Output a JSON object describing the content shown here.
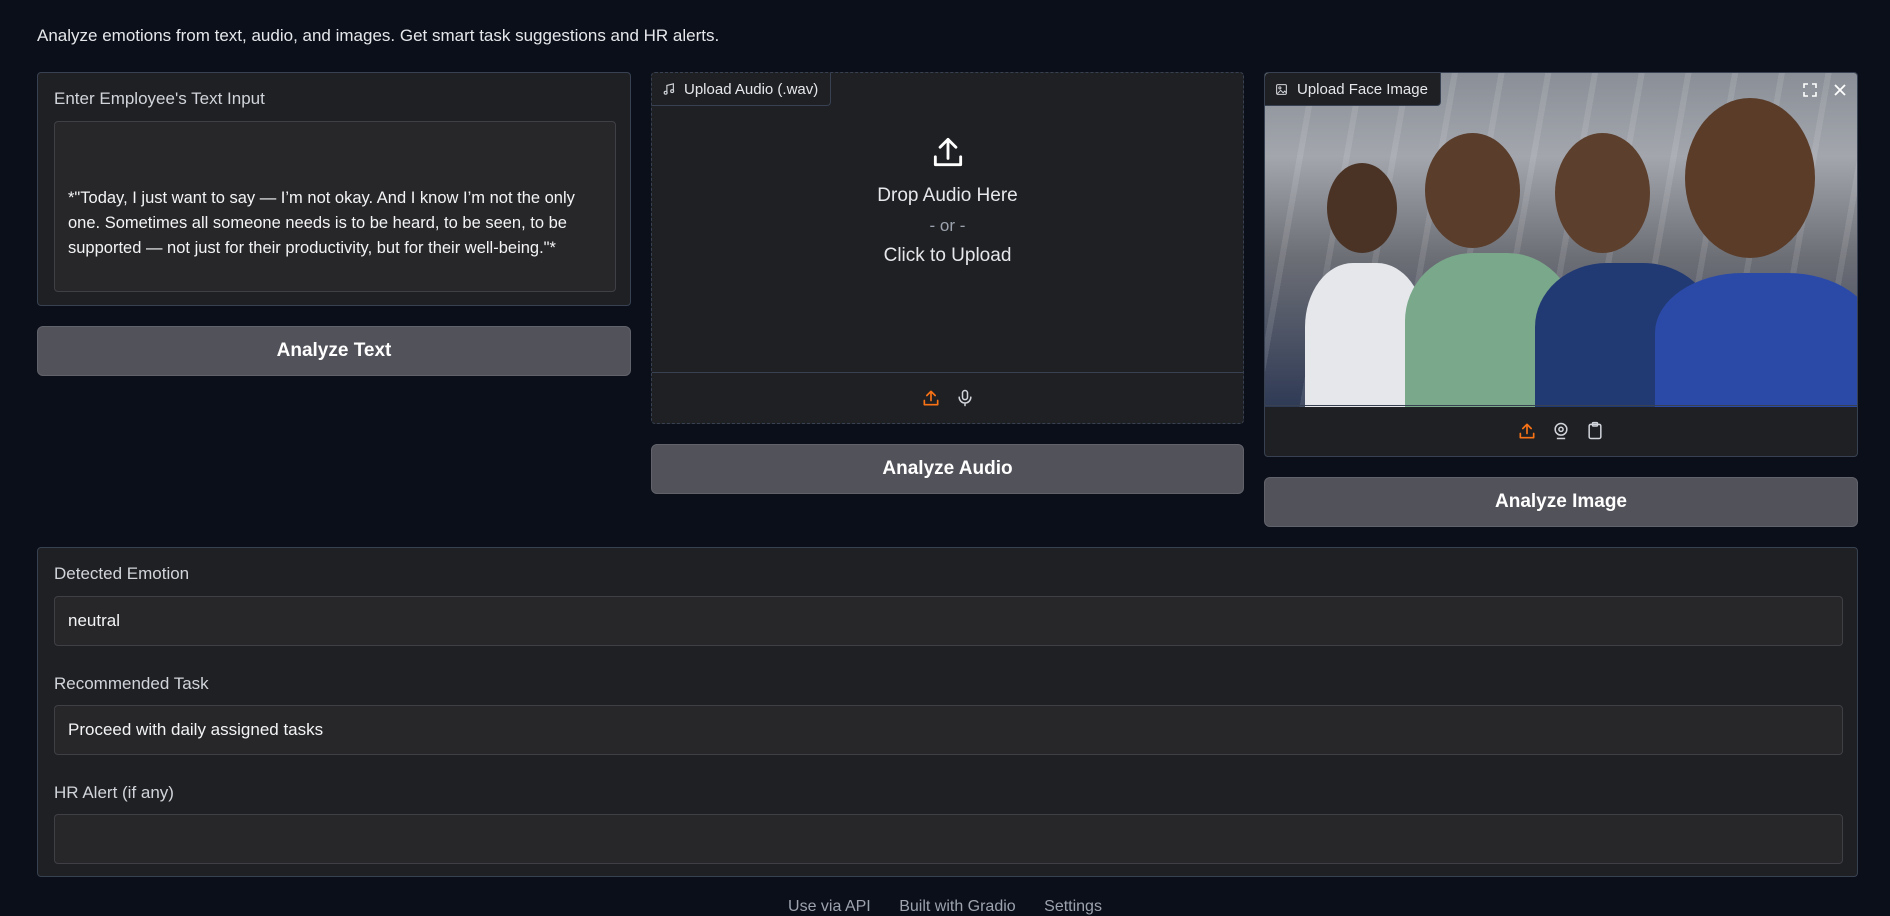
{
  "description": "Analyze emotions from text, audio, and images. Get smart task suggestions and HR alerts.",
  "text_input": {
    "label": "Enter Employee's Text Input",
    "value": "*\"Today, I just want to say — I’m not okay. And I know I’m not the only one. Sometimes all someone needs is to be heard, to be seen, to be supported — not just for their productivity, but for their well-being.\"*"
  },
  "buttons": {
    "analyze_text": "Analyze Text",
    "analyze_audio": "Analyze Audio",
    "analyze_image": "Analyze Image"
  },
  "audio_upload": {
    "label": "Upload Audio (.wav)",
    "drop_text": "Drop Audio Here",
    "or_text": "- or -",
    "click_text": "Click to Upload",
    "icons": [
      "music-note-icon",
      "upload-icon",
      "microphone-icon"
    ]
  },
  "image_upload": {
    "label": "Upload Face Image",
    "icons": [
      "image-icon",
      "fullscreen-icon",
      "close-icon",
      "upload-icon",
      "webcam-icon",
      "clipboard-icon"
    ]
  },
  "results": {
    "emotion_label": "Detected Emotion",
    "emotion_value": "neutral",
    "task_label": "Recommended Task",
    "task_value": "Proceed with daily assigned tasks",
    "hr_label": "HR Alert (if any)",
    "hr_value": ""
  },
  "footer": {
    "api": "Use via API",
    "built": "Built with Gradio",
    "settings": "Settings"
  },
  "colors": {
    "background": "#0b0f19",
    "panel": "#1f2023",
    "button": "#52525b",
    "accent": "#f97316"
  }
}
